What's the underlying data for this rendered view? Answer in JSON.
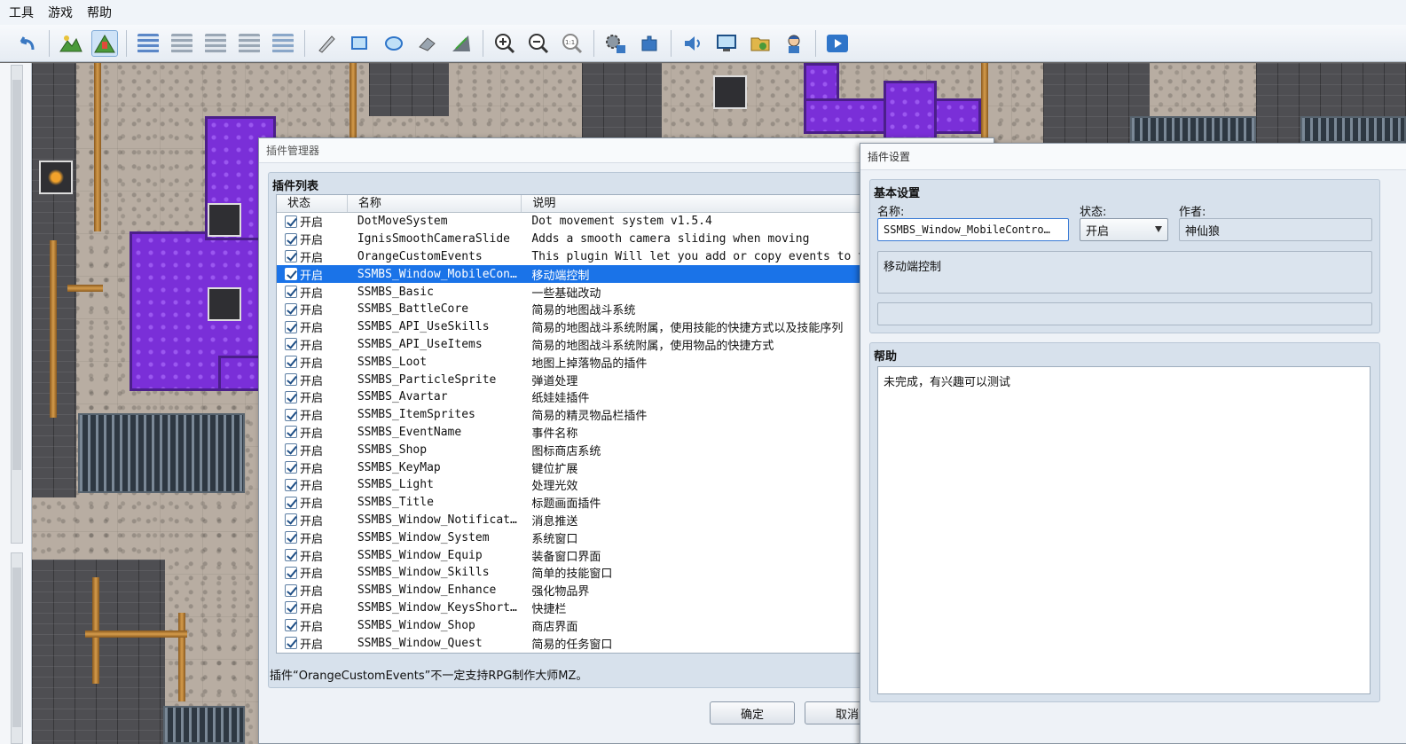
{
  "menu": [
    "工具",
    "游戏",
    "帮助"
  ],
  "toolbar": {
    "icons": [
      "undo-icon",
      "map-mode-icon",
      "event-mode-icon",
      "layer-1-icon",
      "layer-2-icon",
      "layer-3-icon",
      "layer-4-icon",
      "layer-auto-icon",
      "pencil-icon",
      "rectangle-icon",
      "ellipse-icon",
      "fill-icon",
      "shadow-pen-icon",
      "zoom-in-icon",
      "zoom-out-icon",
      "zoom-reset-icon",
      "database-icon",
      "plugin-manager-icon",
      "sound-test-icon",
      "event-searcher-icon",
      "resource-manager-icon",
      "character-generator-icon",
      "playtest-icon"
    ]
  },
  "plugin_manager": {
    "title": "插件管理器",
    "list_title": "插件列表",
    "columns": [
      "状态",
      "名称",
      "说明"
    ],
    "rows": [
      {
        "status": "开启",
        "name": "DotMoveSystem",
        "desc": "Dot movement system v1.5.4",
        "selected": false
      },
      {
        "status": "开启",
        "name": "IgnisSmoothCameraSlide",
        "desc": "Adds a smooth camera sliding when moving",
        "selected": false
      },
      {
        "status": "开启",
        "name": "OrangeCustomEvents",
        "desc": "This plugin Will let you add or copy events to the cur",
        "selected": false
      },
      {
        "status": "开启",
        "name": "SSMBS_Window_MobileContr…",
        "desc": "移动端控制",
        "selected": true
      },
      {
        "status": "开启",
        "name": "SSMBS_Basic",
        "desc": "一些基础改动",
        "selected": false
      },
      {
        "status": "开启",
        "name": "SSMBS_BattleCore",
        "desc": "简易的地图战斗系统",
        "selected": false
      },
      {
        "status": "开启",
        "name": "SSMBS_API_UseSkills",
        "desc": "简易的地图战斗系统附属，使用技能的快捷方式以及技能序列",
        "selected": false
      },
      {
        "status": "开启",
        "name": "SSMBS_API_UseItems",
        "desc": "简易的地图战斗系统附属，使用物品的快捷方式",
        "selected": false
      },
      {
        "status": "开启",
        "name": "SSMBS_Loot",
        "desc": "地图上掉落物品的插件",
        "selected": false
      },
      {
        "status": "开启",
        "name": "SSMBS_ParticleSprite",
        "desc": "弹道处理",
        "selected": false
      },
      {
        "status": "开启",
        "name": "SSMBS_Avartar",
        "desc": "纸娃娃插件",
        "selected": false
      },
      {
        "status": "开启",
        "name": "SSMBS_ItemSprites",
        "desc": "简易的精灵物品栏插件",
        "selected": false
      },
      {
        "status": "开启",
        "name": "SSMBS_EventName",
        "desc": "事件名称",
        "selected": false
      },
      {
        "status": "开启",
        "name": "SSMBS_Shop",
        "desc": "图标商店系统",
        "selected": false
      },
      {
        "status": "开启",
        "name": "SSMBS_KeyMap",
        "desc": "键位扩展",
        "selected": false
      },
      {
        "status": "开启",
        "name": "SSMBS_Light",
        "desc": "处理光效",
        "selected": false
      },
      {
        "status": "开启",
        "name": "SSMBS_Title",
        "desc": "标题画面插件",
        "selected": false
      },
      {
        "status": "开启",
        "name": "SSMBS_Window_Notification",
        "desc": "消息推送",
        "selected": false
      },
      {
        "status": "开启",
        "name": "SSMBS_Window_System",
        "desc": "系统窗口",
        "selected": false
      },
      {
        "status": "开启",
        "name": "SSMBS_Window_Equip",
        "desc": "装备窗口界面",
        "selected": false
      },
      {
        "status": "开启",
        "name": "SSMBS_Window_Skills",
        "desc": "简单的技能窗口",
        "selected": false
      },
      {
        "status": "开启",
        "name": "SSMBS_Window_Enhance",
        "desc": "强化物品界",
        "selected": false
      },
      {
        "status": "开启",
        "name": "SSMBS_Window_KeysShortcut",
        "desc": "快捷栏",
        "selected": false
      },
      {
        "status": "开启",
        "name": "SSMBS_Window_Shop",
        "desc": "商店界面",
        "selected": false
      },
      {
        "status": "开启",
        "name": "SSMBS_Window_Quest",
        "desc": "简易的任务窗口",
        "selected": false
      }
    ],
    "warning": "插件“OrangeCustomEvents”不一定支持RPG制作大师MZ。",
    "ok_label": "确定",
    "cancel_label": "取消"
  },
  "plugin_settings": {
    "title": "插件设置",
    "basic_title": "基本设置",
    "name_label": "名称:",
    "name_value": "SSMBS_Window_MobileContro…",
    "status_label": "状态:",
    "status_value": "开启",
    "author_label": "作者:",
    "author_value": "神仙狼",
    "description": "移动端控制",
    "parameters": "",
    "help_title": "帮助",
    "help_text": "未完成，有兴趣可以测试"
  }
}
